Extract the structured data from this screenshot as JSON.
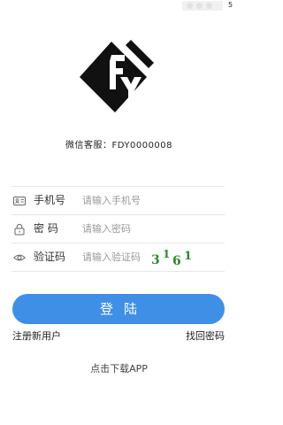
{
  "status_bar": {
    "indicator": "5"
  },
  "logo": {
    "text": "FDY"
  },
  "service": {
    "label": "微信客服：FDY0000008"
  },
  "form": {
    "phone": {
      "label": "手机号",
      "placeholder": "请输入手机号",
      "value": ""
    },
    "password": {
      "label": "密 码",
      "placeholder": "请输入密码",
      "value": ""
    },
    "captcha": {
      "label": "验证码",
      "placeholder": "请输入验证码",
      "value": "",
      "code": [
        "3",
        "1",
        "6",
        "1"
      ]
    }
  },
  "login_button": {
    "label": "登陆"
  },
  "links": {
    "register": "注册新用户",
    "forgot": "找回密码"
  },
  "download": {
    "label": "点击下载APP"
  },
  "colors": {
    "primary": "#3f8fe6",
    "captcha": "#2b8a2b",
    "divider": "#e6e6e6"
  }
}
